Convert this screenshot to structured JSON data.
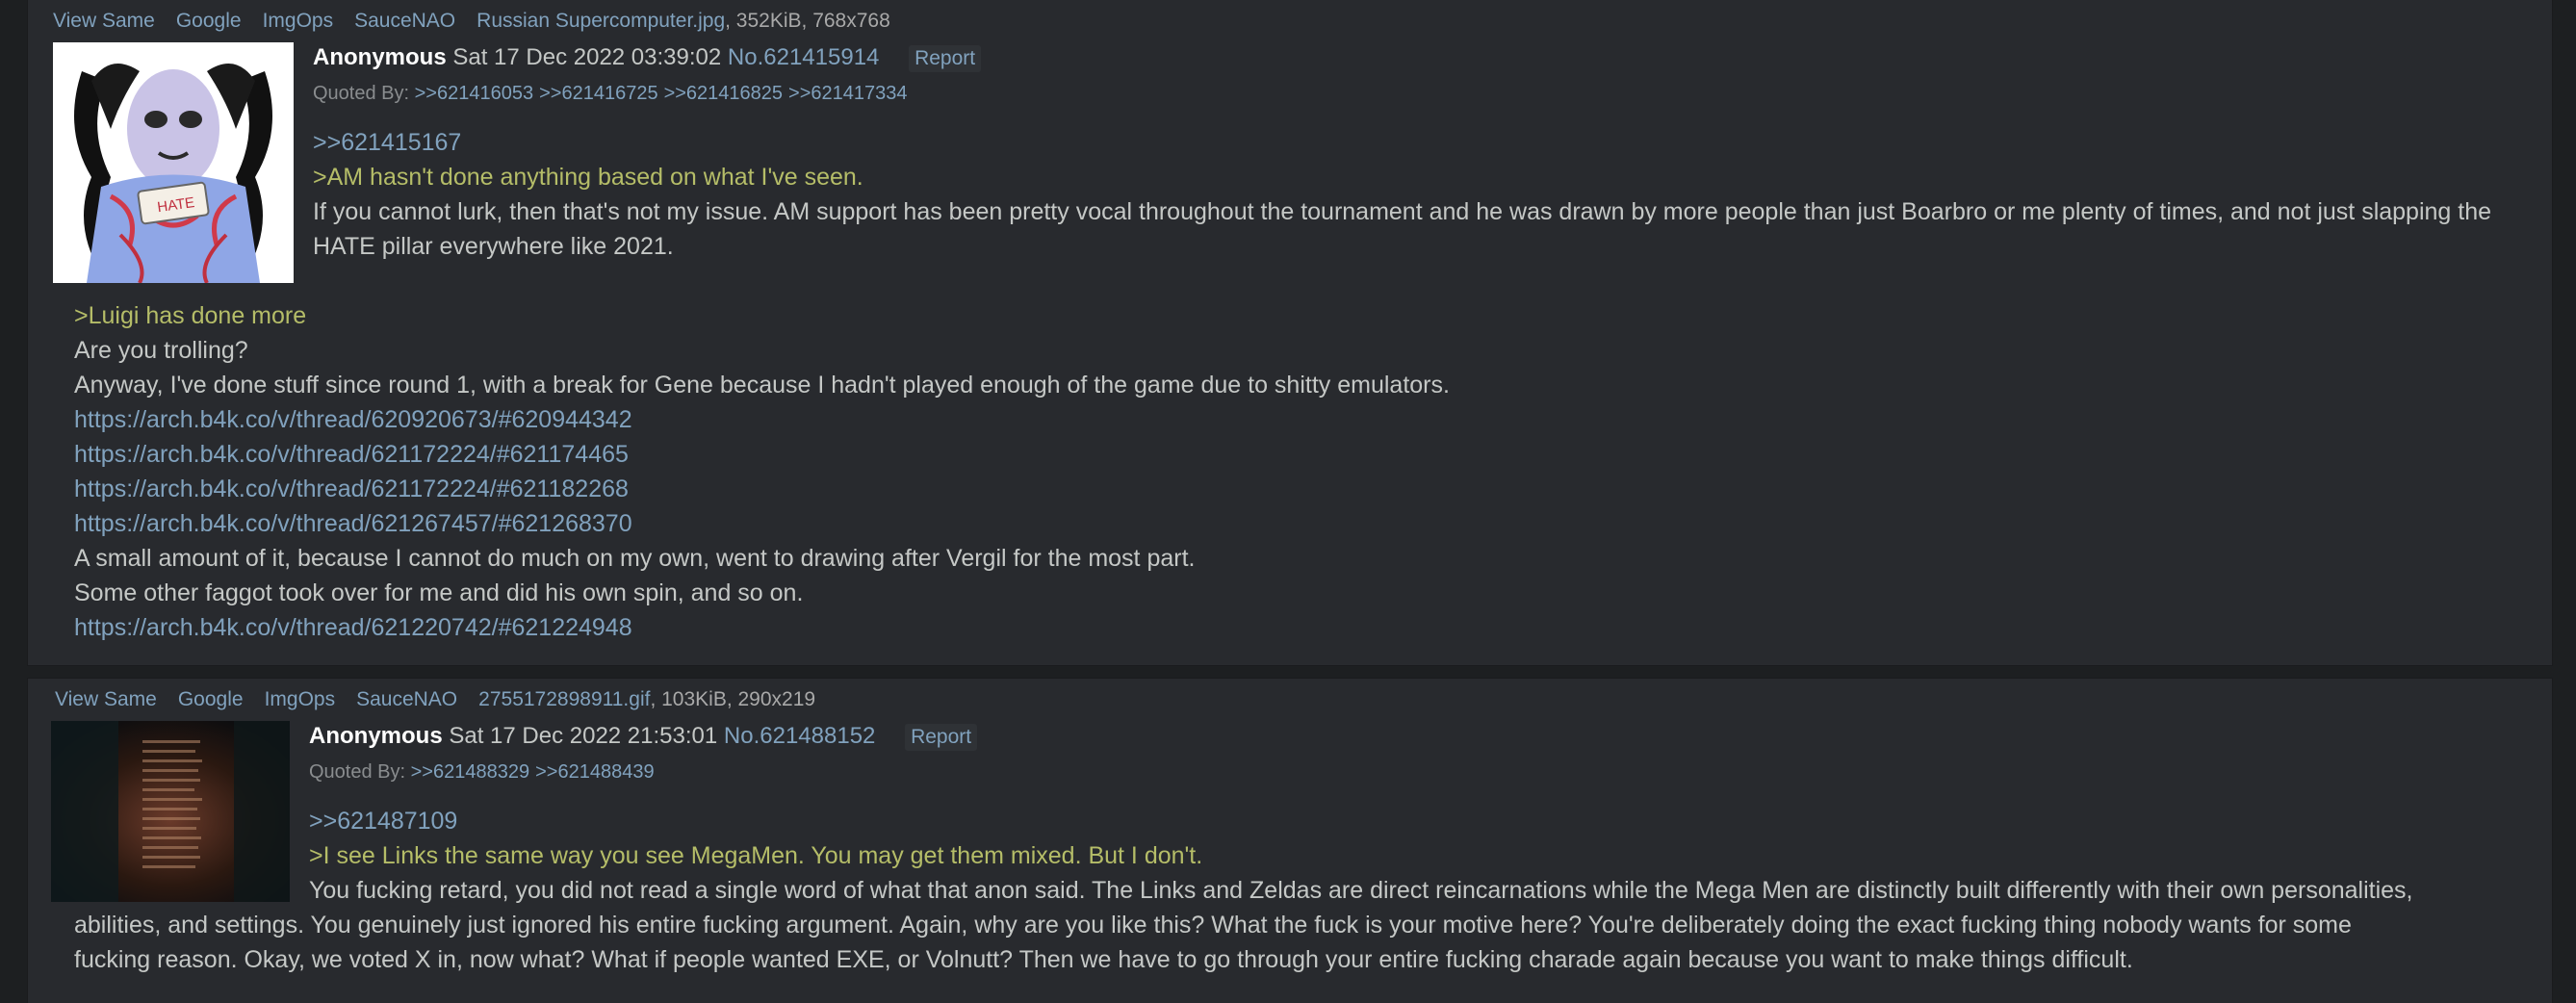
{
  "file_links": [
    "View Same",
    "Google",
    "ImgOps",
    "SauceNAO"
  ],
  "posts": [
    {
      "file_name": "Russian Supercomputer.jpg",
      "file_meta": ", 352KiB, 768x768",
      "name": "Anonymous",
      "date": "Sat 17 Dec 2022 03:39:02",
      "post_no": "No.621415914",
      "report": "Report",
      "quoted_by_label": "Quoted By:",
      "quoted_by": [
        ">>621416053",
        ">>621416725",
        ">>621416825",
        ">>621417334"
      ],
      "reply_to": ">>621415167",
      "greentext": ">AM hasn't done anything based on what I've seen.",
      "para1": "If you cannot lurk, then that's not my issue. AM support has been pretty vocal throughout the tournament and he was drawn by more people than just Boarbro or me plenty of times, and not just slapping the HATE pillar everywhere like 2021.",
      "greentext2": ">Luigi has done more",
      "l1": "Are you trolling?",
      "l2": "Anyway, I've done stuff since round 1, with a break for Gene because I hadn't played enough of the game due to shitty emulators.",
      "urls": [
        "https://arch.b4k.co/v/thread/620920673/#620944342",
        "https://arch.b4k.co/v/thread/621172224/#621174465",
        "https://arch.b4k.co/v/thread/621172224/#621182268",
        "https://arch.b4k.co/v/thread/621267457/#621268370"
      ],
      "l3": "A small amount of it, because I cannot do much on my own, went to drawing after Vergil for the most part.",
      "l4": "Some other faggot took over for me and did his own spin, and so on.",
      "url_last": "https://arch.b4k.co/v/thread/621220742/#621224948",
      "thumb_label": "HATE"
    },
    {
      "file_name": "2755172898911.gif",
      "file_meta": ", 103KiB, 290x219",
      "name": "Anonymous",
      "date": "Sat 17 Dec 2022 21:53:01",
      "post_no": "No.621488152",
      "report": "Report",
      "quoted_by_label": "Quoted By:",
      "quoted_by": [
        ">>621488329",
        ">>621488439"
      ],
      "reply_to": ">>621487109",
      "greentext": ">I see Links the same way you see MegaMen. You may get them mixed. But I don't.",
      "para_a": "You fucking retard, you did not read a single word of what that anon said. The Links and Zeldas are direct reincarnations while the Mega Men are distinctly built differently with their own personalities,",
      "para_b": "abilities, and settings. You genuinely just ignored his entire fucking argument. Again, why are you like this? What the fuck is your motive here? You're deliberately doing the exact fucking thing nobody wants for some",
      "para_c": "fucking reason. Okay, we voted X in, now what? What if people wanted EXE, or Volnutt? Then we have to go through your entire fucking charade again because you want to make things difficult."
    }
  ]
}
